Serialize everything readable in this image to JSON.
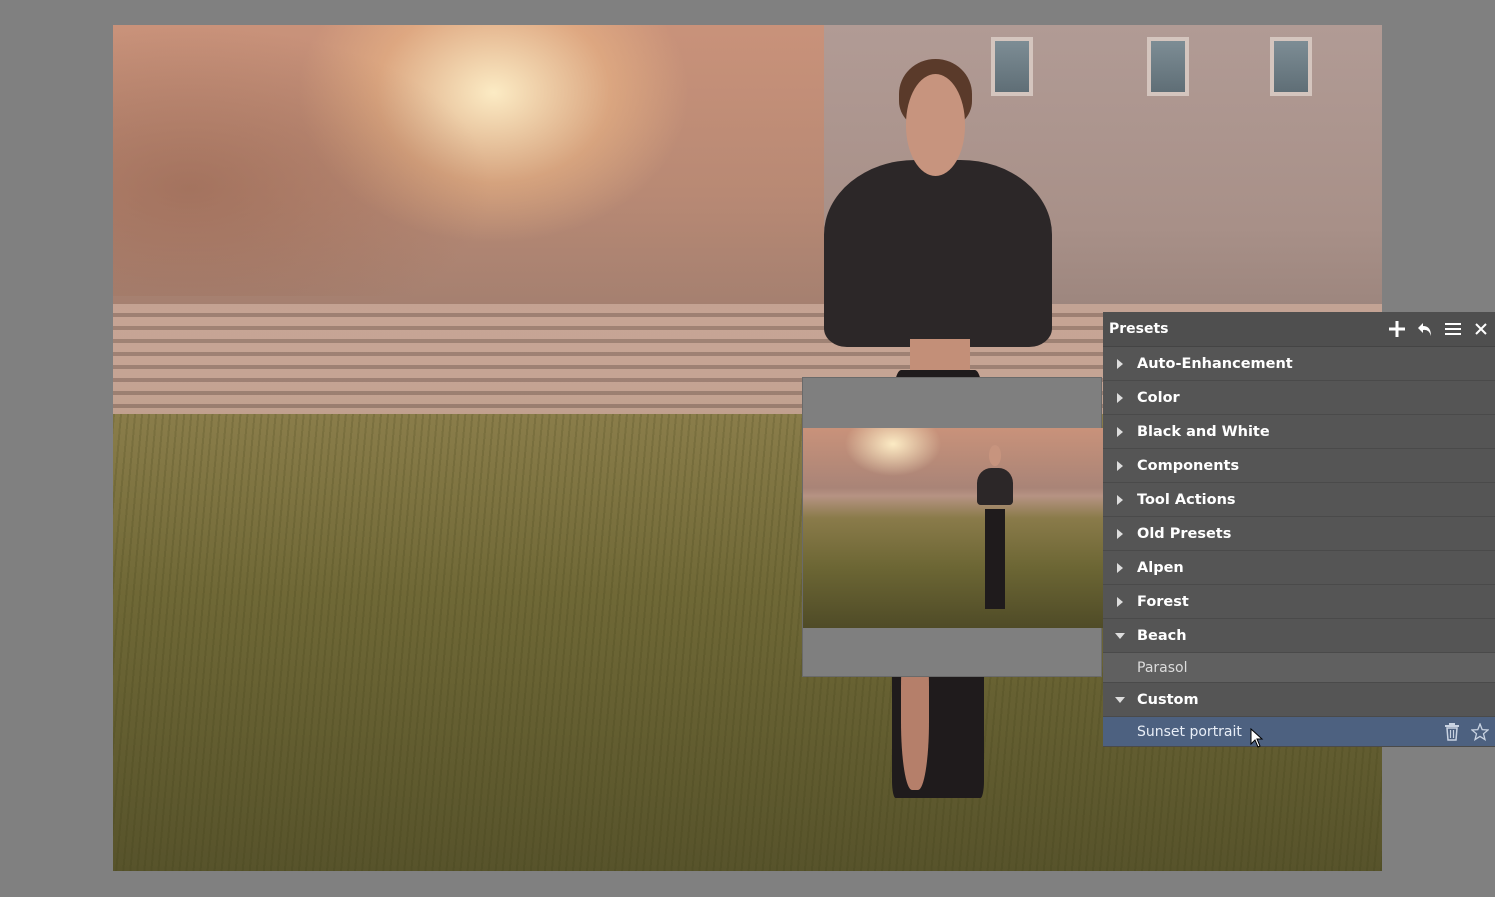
{
  "panel": {
    "title": "Presets",
    "header_icons": [
      "plus-icon",
      "undo-icon",
      "menu-icon",
      "close-icon"
    ],
    "categories": [
      {
        "label": "Auto-Enhancement",
        "expanded": false
      },
      {
        "label": "Color",
        "expanded": false
      },
      {
        "label": "Black and White",
        "expanded": false
      },
      {
        "label": "Components",
        "expanded": false
      },
      {
        "label": "Tool Actions",
        "expanded": false
      },
      {
        "label": "Old Presets",
        "expanded": false
      },
      {
        "label": "Alpen",
        "expanded": false
      },
      {
        "label": "Forest",
        "expanded": false
      },
      {
        "label": "Beach",
        "expanded": true,
        "items": [
          {
            "label": "Parasol"
          }
        ]
      },
      {
        "label": "Custom",
        "expanded": true,
        "items": [
          {
            "label": "Sunset portrait",
            "selected": true
          }
        ]
      }
    ],
    "item_action_icons": [
      "trash-icon",
      "star-icon"
    ]
  },
  "colors": {
    "background": "#808080",
    "panel": "#555555",
    "selected": "#4d6180"
  }
}
